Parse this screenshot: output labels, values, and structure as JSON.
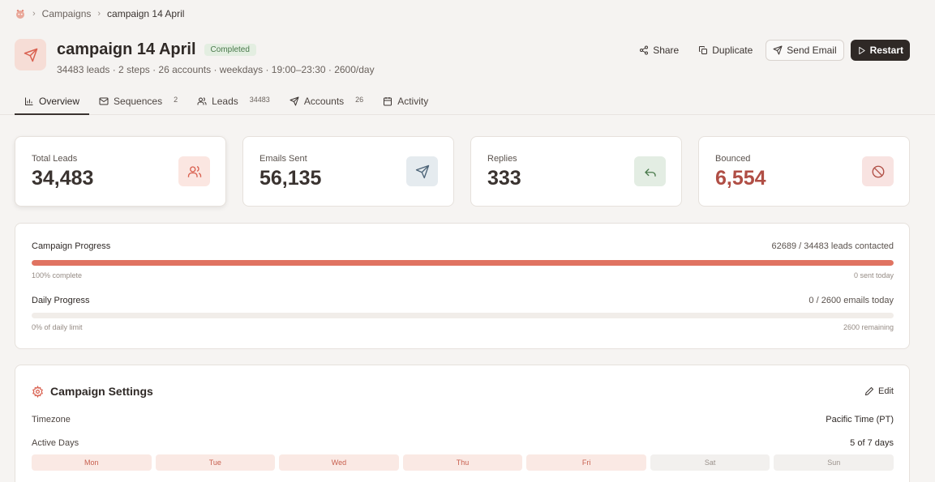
{
  "breadcrumb": {
    "items": [
      "Campaigns",
      "campaign 14 April"
    ]
  },
  "campaign": {
    "title": "campaign 14 April",
    "status": "Completed",
    "subtitle": "34483 leads · 2 steps · 26 accounts · weekdays · 19:00–23:30 · 2600/day"
  },
  "actions": {
    "share": "Share",
    "duplicate": "Duplicate",
    "send_email": "Send Email",
    "restart": "Restart"
  },
  "tabs": [
    {
      "label": "Overview",
      "count": ""
    },
    {
      "label": "Sequences",
      "count": "2"
    },
    {
      "label": "Leads",
      "count": "34483"
    },
    {
      "label": "Accounts",
      "count": "26"
    },
    {
      "label": "Activity",
      "count": ""
    }
  ],
  "stats": [
    {
      "label": "Total Leads",
      "value": "34,483"
    },
    {
      "label": "Emails Sent",
      "value": "56,135"
    },
    {
      "label": "Replies",
      "value": "333"
    },
    {
      "label": "Bounced",
      "value": "6,554"
    }
  ],
  "progress": {
    "campaign": {
      "label": "Campaign Progress",
      "summary": "62689 / 34483 leads contacted",
      "percent_text": "100% complete",
      "today_text": "0 sent today",
      "fraction": 1.0
    },
    "daily": {
      "label": "Daily Progress",
      "summary": "0 / 2600 emails today",
      "percent_text": "0% of daily limit",
      "remaining_text": "2600 remaining",
      "fraction": 0.0
    }
  },
  "settings": {
    "title": "Campaign Settings",
    "edit": "Edit",
    "timezone_label": "Timezone",
    "timezone_value": "Pacific Time (PT)",
    "active_days_label": "Active Days",
    "active_days_value": "5 of 7 days",
    "days": [
      {
        "label": "Mon",
        "active": true
      },
      {
        "label": "Tue",
        "active": true
      },
      {
        "label": "Wed",
        "active": true
      },
      {
        "label": "Thu",
        "active": true
      },
      {
        "label": "Fri",
        "active": true
      },
      {
        "label": "Sat",
        "active": false
      },
      {
        "label": "Sun",
        "active": false
      }
    ]
  },
  "colors": {
    "accent": "#e07361",
    "danger": "#b04e45",
    "success_bg": "#e3eee1"
  }
}
